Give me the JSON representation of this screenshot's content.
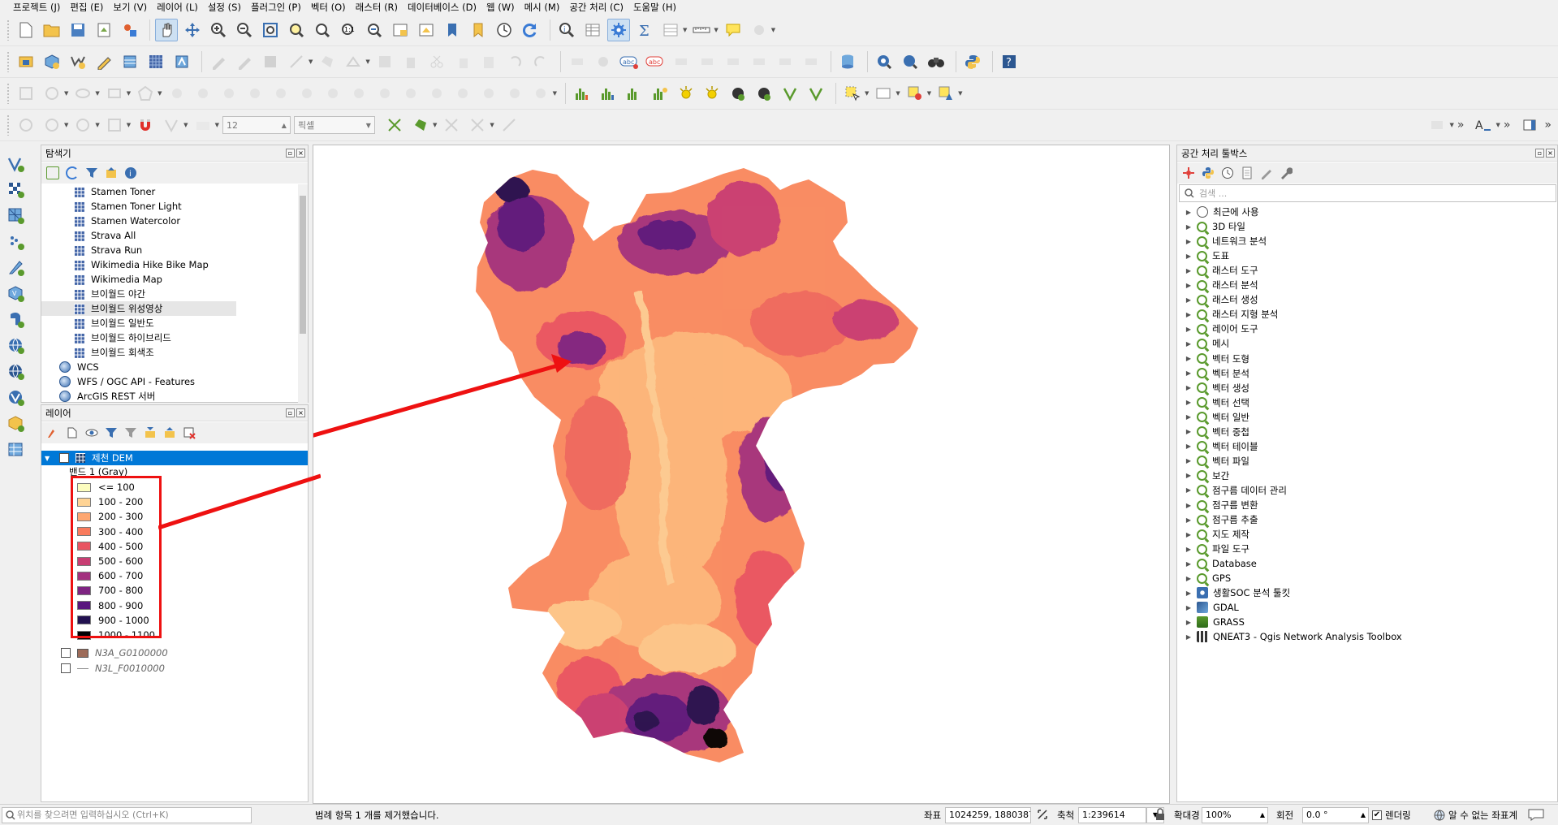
{
  "menu": [
    "프로젝트 (J)",
    "편집 (E)",
    "보기 (V)",
    "레이어 (L)",
    "설정 (S)",
    "플러그인 (P)",
    "벡터 (O)",
    "래스터 (R)",
    "데이터베이스 (D)",
    "웹 (W)",
    "메시 (M)",
    "공간 처리 (C)",
    "도움말 (H)"
  ],
  "snapping": {
    "tolerance": "12",
    "units": "픽셀"
  },
  "browser": {
    "title": "탐색기",
    "items": [
      {
        "label": "Stamen Toner",
        "icon": "xyz-tile-icon"
      },
      {
        "label": "Stamen Toner Light",
        "icon": "xyz-tile-icon"
      },
      {
        "label": "Stamen Watercolor",
        "icon": "xyz-tile-icon"
      },
      {
        "label": "Strava All",
        "icon": "xyz-tile-icon"
      },
      {
        "label": "Strava Run",
        "icon": "xyz-tile-icon"
      },
      {
        "label": "Wikimedia Hike Bike Map",
        "icon": "xyz-tile-icon"
      },
      {
        "label": "Wikimedia Map",
        "icon": "xyz-tile-icon"
      },
      {
        "label": "브이월드 야간",
        "icon": "xyz-tile-icon"
      },
      {
        "label": "브이월드 위성영상",
        "icon": "xyz-tile-icon"
      },
      {
        "label": "브이월드 일반도",
        "icon": "xyz-tile-icon"
      },
      {
        "label": "브이월드 하이브리드",
        "icon": "xyz-tile-icon"
      },
      {
        "label": "브이월드 회색조",
        "icon": "xyz-tile-icon"
      },
      {
        "label": "WCS",
        "icon": "globe-icon"
      },
      {
        "label": "WFS / OGC API - Features",
        "icon": "globe-icon"
      },
      {
        "label": "ArcGIS REST 서버",
        "icon": "globe-icon"
      }
    ]
  },
  "layers": {
    "title": "레이어",
    "dem": {
      "name": "제천 DEM",
      "band": "밴드 1 (Gray)"
    },
    "legend": [
      {
        "label": "<= 100",
        "color": "#fcfdbf"
      },
      {
        "label": "100 - 200",
        "color": "#fed395"
      },
      {
        "label": "200 - 300",
        "color": "#fea772"
      },
      {
        "label": "300 - 400",
        "color": "#f97b5d"
      },
      {
        "label": "400 - 500",
        "color": "#e95462"
      },
      {
        "label": "500 - 600",
        "color": "#c83e73"
      },
      {
        "label": "600 - 700",
        "color": "#a3307e"
      },
      {
        "label": "700 - 800",
        "color": "#7e2482"
      },
      {
        "label": "800 - 900",
        "color": "#5a167e"
      },
      {
        "label": "900 - 1000",
        "color": "#221150"
      },
      {
        "label": "1000 - 1100",
        "color": "#000004"
      }
    ],
    "others": [
      {
        "name": "N3A_G0100000",
        "kind": "polygon",
        "color": "#9d6b59"
      },
      {
        "name": "N3L_F0010000",
        "kind": "line",
        "color": "#888888"
      }
    ]
  },
  "toolbox": {
    "title": "공간 처리 툴박스",
    "search_placeholder": "검색 ...",
    "items": [
      {
        "label": "최근에 사용",
        "icon": "clock-icon"
      },
      {
        "label": "3D 타일",
        "icon": "qgis-icon"
      },
      {
        "label": "네트워크 분석",
        "icon": "qgis-icon"
      },
      {
        "label": "도표",
        "icon": "qgis-icon"
      },
      {
        "label": "래스터 도구",
        "icon": "qgis-icon"
      },
      {
        "label": "래스터 분석",
        "icon": "qgis-icon"
      },
      {
        "label": "래스터 생성",
        "icon": "qgis-icon"
      },
      {
        "label": "래스터 지형 분석",
        "icon": "qgis-icon"
      },
      {
        "label": "레이어 도구",
        "icon": "qgis-icon"
      },
      {
        "label": "메시",
        "icon": "qgis-icon"
      },
      {
        "label": "벡터 도형",
        "icon": "qgis-icon"
      },
      {
        "label": "벡터 분석",
        "icon": "qgis-icon"
      },
      {
        "label": "벡터 생성",
        "icon": "qgis-icon"
      },
      {
        "label": "벡터 선택",
        "icon": "qgis-icon"
      },
      {
        "label": "벡터 일반",
        "icon": "qgis-icon"
      },
      {
        "label": "벡터 중첩",
        "icon": "qgis-icon"
      },
      {
        "label": "벡터 테이블",
        "icon": "qgis-icon"
      },
      {
        "label": "벡터 파일",
        "icon": "qgis-icon"
      },
      {
        "label": "보간",
        "icon": "qgis-icon"
      },
      {
        "label": "점구름 데이터 관리",
        "icon": "qgis-icon"
      },
      {
        "label": "점구름 변환",
        "icon": "qgis-icon"
      },
      {
        "label": "점구름 추출",
        "icon": "qgis-icon"
      },
      {
        "label": "지도 제작",
        "icon": "qgis-icon"
      },
      {
        "label": "파일 도구",
        "icon": "qgis-icon"
      },
      {
        "label": "Database",
        "icon": "qgis-icon"
      },
      {
        "label": "GPS",
        "icon": "qgis-icon"
      },
      {
        "label": "생활SOC 분석 툴킷",
        "icon": "gear-icon"
      },
      {
        "label": "GDAL",
        "icon": "gdal-icon"
      },
      {
        "label": "GRASS",
        "icon": "grass-icon"
      },
      {
        "label": "QNEAT3 - Qgis Network Analysis Toolbox",
        "icon": "qneat-icon"
      }
    ]
  },
  "statusbar": {
    "locator_placeholder": "위치를 찾으려면 입력하십시오 (Ctrl+K)",
    "message": "범례 항목 1 개를 제거했습니다.",
    "coord_label": "좌표",
    "coord_value": "1024259, 1880387",
    "scale_label": "축척",
    "scale_value": "1:239614",
    "magnifier_label": "확대경",
    "magnifier_value": "100%",
    "rotation_label": "회전",
    "rotation_value": "0.0 °",
    "render_label": "렌더링",
    "crs_label": "알 수 없는 좌표계"
  },
  "colors": {
    "selection": "#0078d7",
    "annotation_red": "#ee1111",
    "qgis_green": "#5a9a2d"
  }
}
